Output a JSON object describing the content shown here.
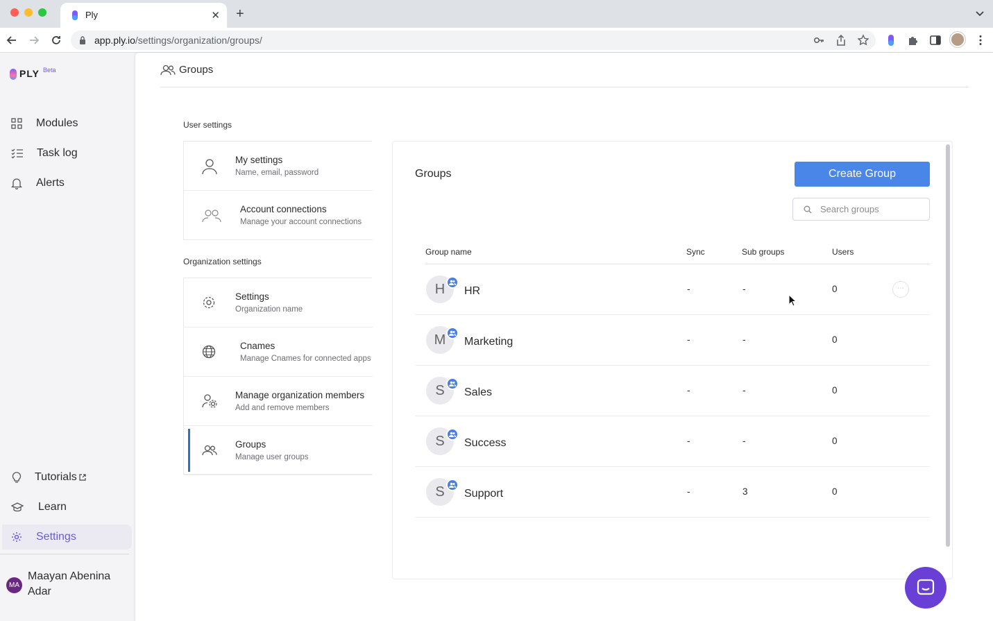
{
  "browser": {
    "tab_title": "Ply",
    "url_host": "app.ply.io",
    "url_path": "/settings/organization/groups/"
  },
  "app": {
    "logo": "PLY",
    "beta_label": "Beta"
  },
  "sidebar": {
    "items": [
      {
        "label": "Modules",
        "icon": "grid-icon"
      },
      {
        "label": "Task log",
        "icon": "checklist-icon"
      },
      {
        "label": "Alerts",
        "icon": "bell-icon"
      }
    ],
    "bottom_items": [
      {
        "label": "Tutorials",
        "icon": "lightbulb-icon"
      },
      {
        "label": "Learn",
        "icon": "graduation-cap-icon"
      },
      {
        "label": "Settings",
        "icon": "gear-icon"
      }
    ],
    "user": {
      "initials": "MA",
      "name": "Maayan Abenina Adar"
    }
  },
  "header": {
    "title": "Groups"
  },
  "settings_nav": {
    "user_settings_label": "User settings",
    "org_settings_label": "Organization settings",
    "user_items": [
      {
        "title": "My settings",
        "subtitle": "Name, email, password"
      },
      {
        "title": "Account connections",
        "subtitle": "Manage your account connections"
      }
    ],
    "org_items": [
      {
        "title": "Settings",
        "subtitle": "Organization name"
      },
      {
        "title": "Cnames",
        "subtitle": "Manage Cnames for connected apps"
      },
      {
        "title": "Manage organization members",
        "subtitle": "Add and remove members"
      },
      {
        "title": "Groups",
        "subtitle": "Manage user groups"
      }
    ]
  },
  "groups_panel": {
    "title": "Groups",
    "create_button": "Create Group",
    "search_placeholder": "Search groups",
    "columns": [
      "Group name",
      "Sync",
      "Sub groups",
      "Users"
    ],
    "rows": [
      {
        "initial": "H",
        "name": "HR",
        "sync": "-",
        "sub_groups": "-",
        "users": "0"
      },
      {
        "initial": "M",
        "name": "Marketing",
        "sync": "-",
        "sub_groups": "-",
        "users": "0"
      },
      {
        "initial": "S",
        "name": "Sales",
        "sync": "-",
        "sub_groups": "-",
        "users": "0"
      },
      {
        "initial": "S",
        "name": "Success",
        "sync": "-",
        "sub_groups": "-",
        "users": "0"
      },
      {
        "initial": "S",
        "name": "Support",
        "sync": "-",
        "sub_groups": "3",
        "users": "0"
      }
    ],
    "more_button": "···"
  },
  "colors": {
    "accent": "#4a86e8",
    "active_nav": "#6b5cd4",
    "chat_bubble": "#6a3fd6"
  }
}
